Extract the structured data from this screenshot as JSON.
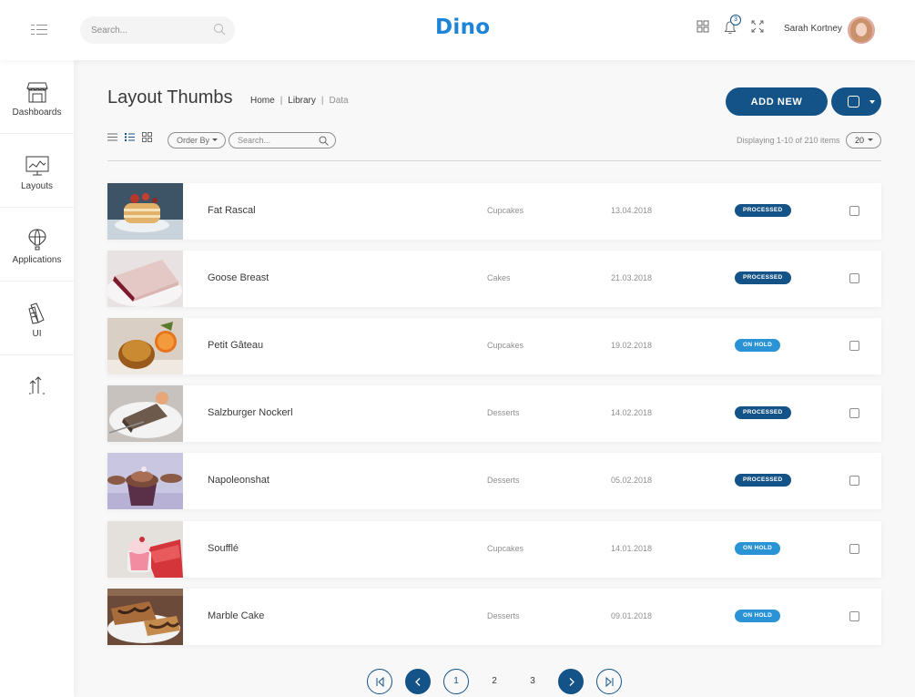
{
  "header": {
    "search_placeholder": "Search...",
    "logo_text": "Dino",
    "notification_count": "3",
    "user_name": "Sarah Kortney"
  },
  "sidebar": {
    "items": [
      {
        "label": "Dashboards",
        "icon": "store-icon"
      },
      {
        "label": "Layouts",
        "icon": "monitor-icon"
      },
      {
        "label": "Applications",
        "icon": "air-balloon-icon"
      },
      {
        "label": "UI",
        "icon": "pens-icon"
      },
      {
        "label": "",
        "icon": "sort-arrows-icon"
      }
    ]
  },
  "page": {
    "title": "Layout Thumbs",
    "breadcrumb": [
      "Home",
      "Library",
      "Data"
    ],
    "add_new_label": "ADD NEW"
  },
  "toolbar": {
    "order_by_label": "Order By",
    "search_placeholder": "Search...",
    "display_text": "Displaying 1-10 of 210 items",
    "page_size": "20"
  },
  "items": [
    {
      "name": "Fat Rascal",
      "category": "Cupcakes",
      "date": "13.04.2018",
      "status": "PROCESSED",
      "status_type": "processed"
    },
    {
      "name": "Goose Breast",
      "category": "Cakes",
      "date": "21.03.2018",
      "status": "PROCESSED",
      "status_type": "processed"
    },
    {
      "name": "Petit Gâteau",
      "category": "Cupcakes",
      "date": "19.02.2018",
      "status": "ON HOLD",
      "status_type": "onhold"
    },
    {
      "name": "Salzburger Nockerl",
      "category": "Desserts",
      "date": "14.02.2018",
      "status": "PROCESSED",
      "status_type": "processed"
    },
    {
      "name": "Napoleonshat",
      "category": "Desserts",
      "date": "05.02.2018",
      "status": "PROCESSED",
      "status_type": "processed"
    },
    {
      "name": "Soufflé",
      "category": "Cupcakes",
      "date": "14.01.2018",
      "status": "ON HOLD",
      "status_type": "onhold"
    },
    {
      "name": "Marble Cake",
      "category": "Desserts",
      "date": "09.01.2018",
      "status": "ON HOLD",
      "status_type": "onhold"
    }
  ],
  "pagination": {
    "pages": [
      "1",
      "2",
      "3"
    ],
    "current": "1"
  },
  "colors": {
    "primary": "#145388",
    "accent": "#2a93d5",
    "logo": "#1e84d8",
    "background": "#f8f8f8"
  }
}
